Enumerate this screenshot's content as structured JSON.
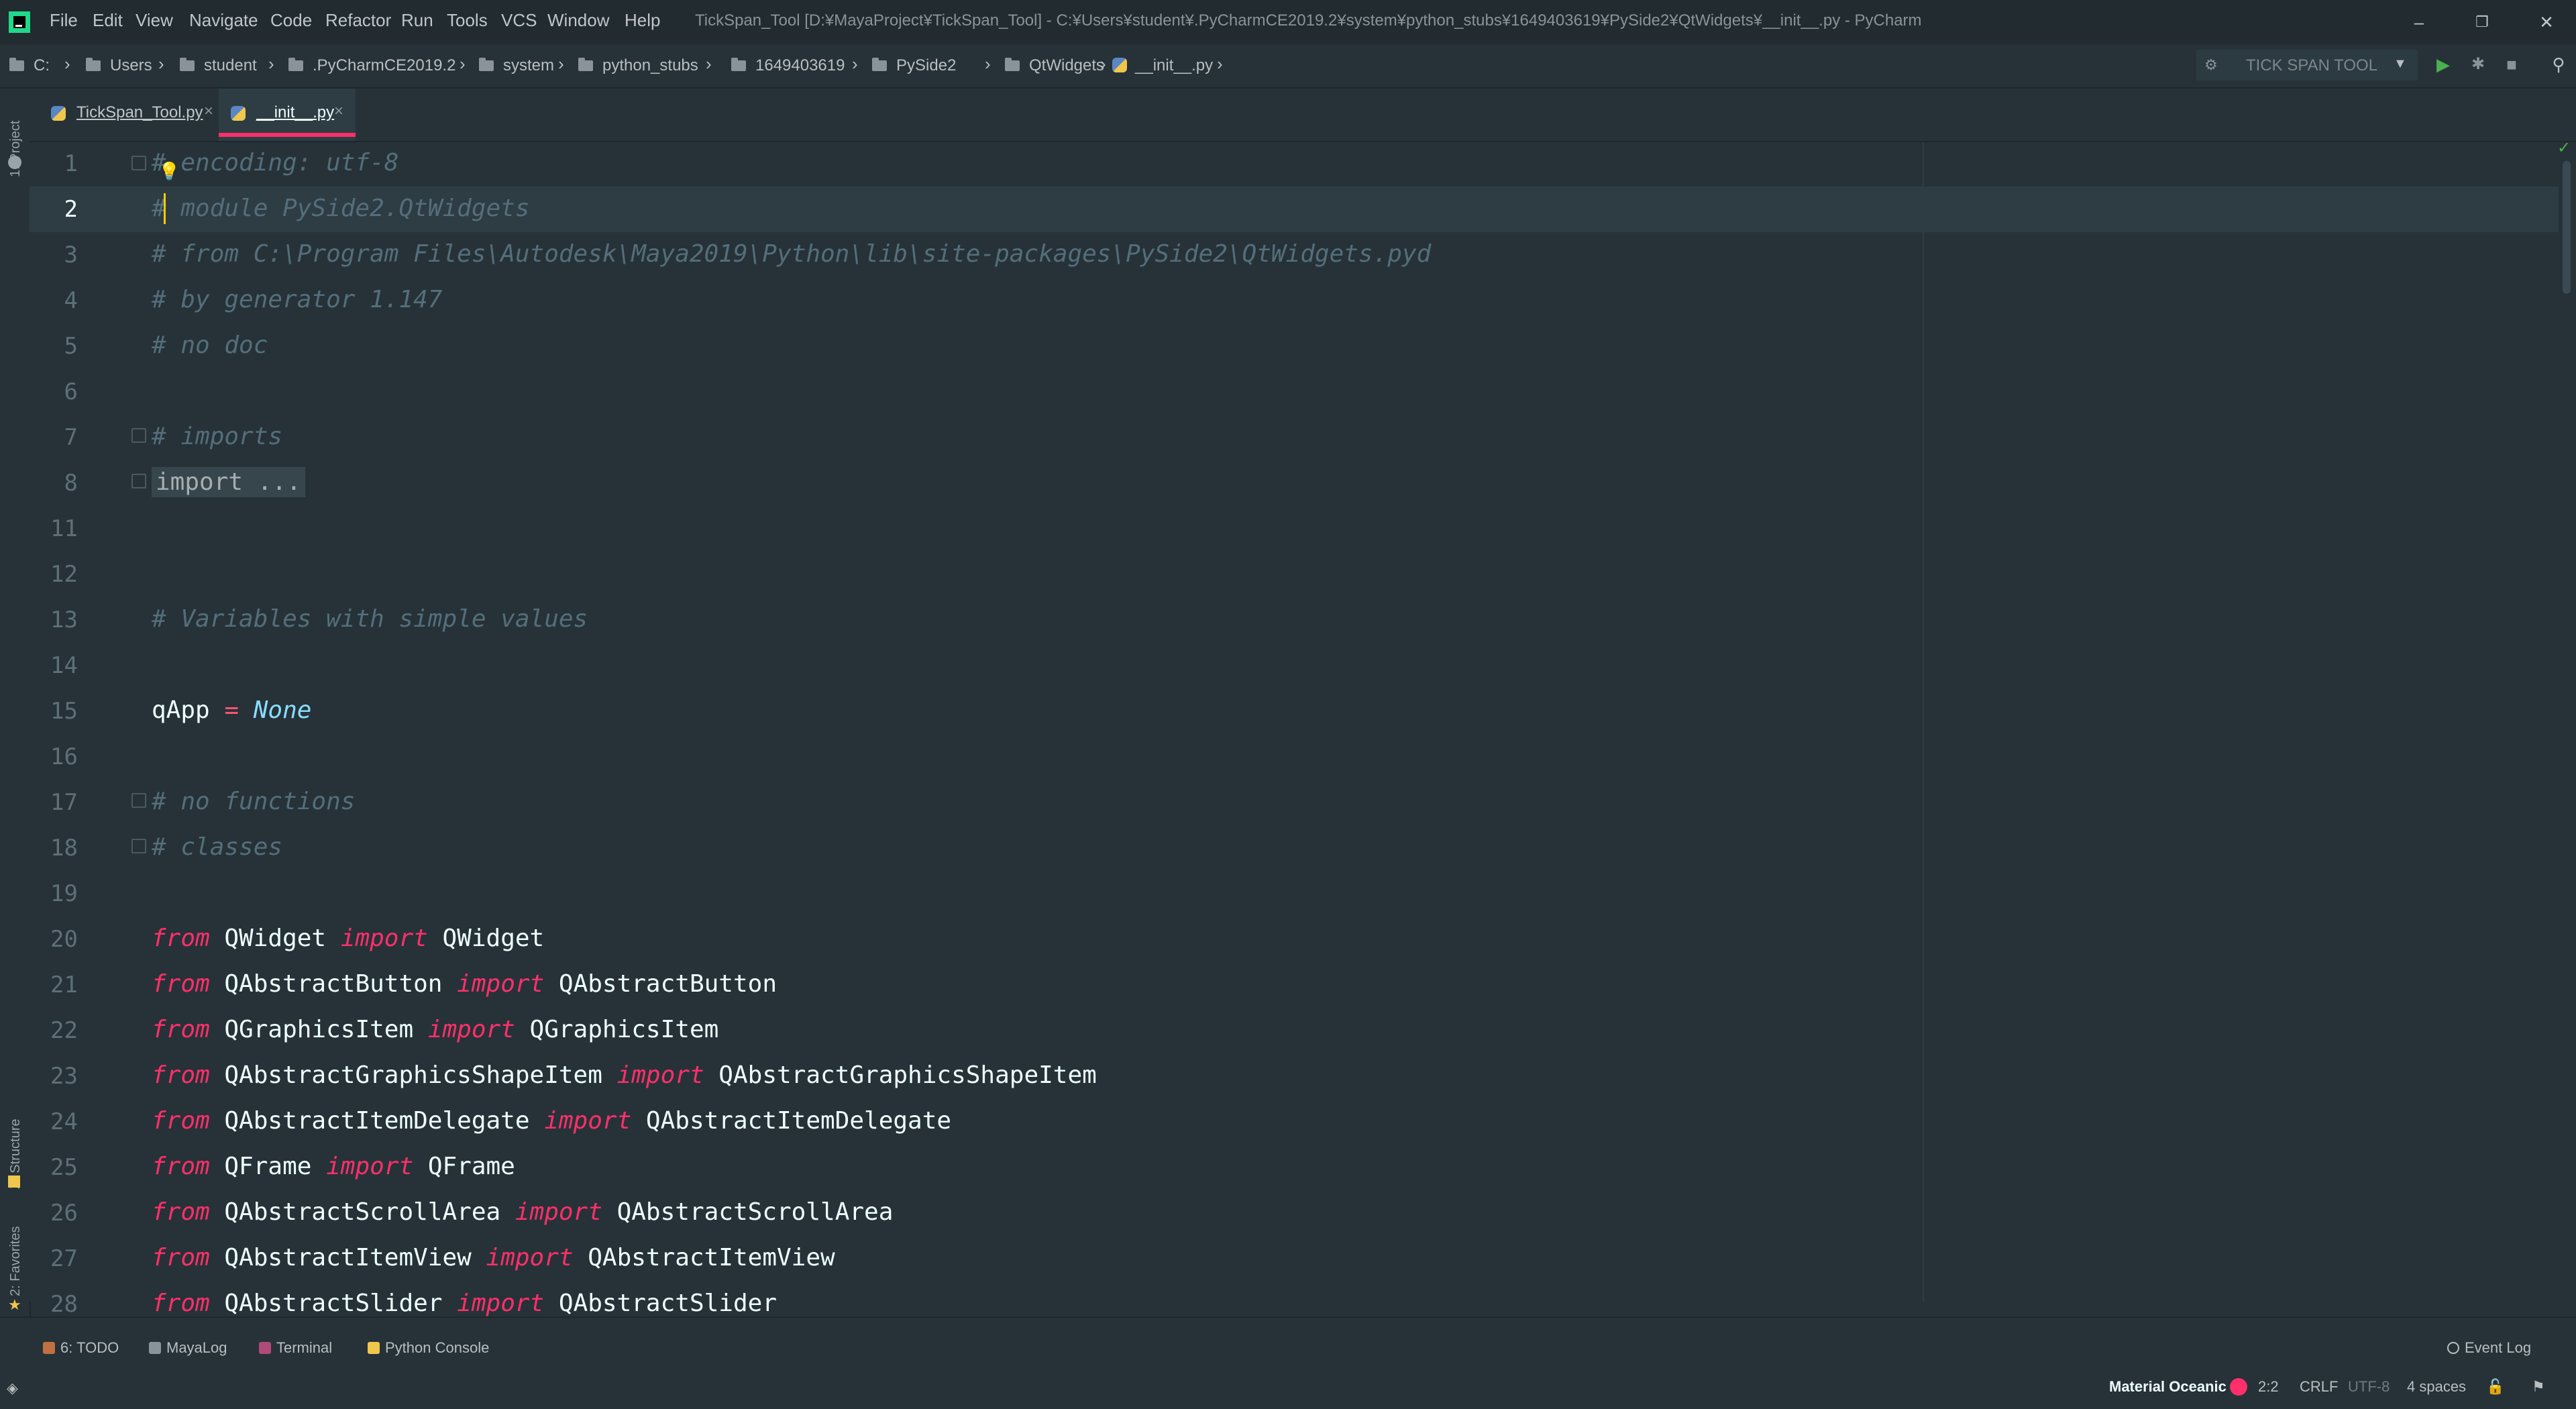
{
  "titlebar": {
    "menu": [
      "File",
      "Edit",
      "View",
      "Navigate",
      "Code",
      "Refactor",
      "Run",
      "Tools",
      "VCS",
      "Window",
      "Help"
    ],
    "window_title": "TickSpan_Tool [D:¥MayaProject¥TickSpan_Tool] - C:¥Users¥student¥.PyCharmCE2019.2¥system¥python_stubs¥1649403619¥PySide2¥QtWidgets¥__init__.py - PyCharm",
    "controls": {
      "minimize": "–",
      "restore": "❐",
      "close": "✕"
    }
  },
  "breadcrumb": [
    "C:",
    "Users",
    "student",
    ".PyCharmCE2019.2",
    "system",
    "python_stubs",
    "1649403619",
    "PySide2",
    "QtWidgets",
    "__init__.py"
  ],
  "run_config": {
    "label": "TICK SPAN TOOL"
  },
  "left_strip": {
    "project": "1: Project",
    "structure": "Z: Structure",
    "favorites": "2: Favorites"
  },
  "tabs": [
    {
      "label": "TickSpan_Tool.py",
      "active": false
    },
    {
      "label": "__init__.py",
      "active": true
    }
  ],
  "editor": {
    "lines": [
      {
        "n": "1",
        "text": "# encoding: utf-8"
      },
      {
        "n": "2",
        "text": "# module PySide2.QtWidgets"
      },
      {
        "n": "3",
        "text": "# from C:\\Program Files\\Autodesk\\Maya2019\\Python\\lib\\site-packages\\PySide2\\QtWidgets.pyd"
      },
      {
        "n": "4",
        "text": "# by generator 1.147"
      },
      {
        "n": "5",
        "text": "# no doc"
      },
      {
        "n": "6",
        "text": ""
      },
      {
        "n": "7",
        "text": "# imports"
      },
      {
        "n": "8",
        "text": "import ..."
      },
      {
        "n": "11",
        "text": ""
      },
      {
        "n": "12",
        "text": ""
      },
      {
        "n": "13",
        "text": "# Variables with simple values"
      },
      {
        "n": "14",
        "text": ""
      },
      {
        "n": "15",
        "var": "qApp",
        "op": "=",
        "val": "None"
      },
      {
        "n": "16",
        "text": ""
      },
      {
        "n": "17",
        "text": "# no functions"
      },
      {
        "n": "18",
        "text": "# classes"
      },
      {
        "n": "19",
        "text": ""
      },
      {
        "n": "20",
        "mod": "QWidget",
        "name": "QWidget"
      },
      {
        "n": "21",
        "mod": "QAbstractButton",
        "name": "QAbstractButton"
      },
      {
        "n": "22",
        "mod": "QGraphicsItem",
        "name": "QGraphicsItem"
      },
      {
        "n": "23",
        "mod": "QAbstractGraphicsShapeItem",
        "name": "QAbstractGraphicsShapeItem"
      },
      {
        "n": "24",
        "mod": "QAbstractItemDelegate",
        "name": "QAbstractItemDelegate"
      },
      {
        "n": "25",
        "mod": "QFrame",
        "name": "QFrame"
      },
      {
        "n": "26",
        "mod": "QAbstractScrollArea",
        "name": "QAbstractScrollArea"
      },
      {
        "n": "27",
        "mod": "QAbstractItemView",
        "name": "QAbstractItemView"
      },
      {
        "n": "28",
        "mod": "QAbstractSlider",
        "name": "QAbstractSlider"
      }
    ],
    "kw_from": "from",
    "kw_import": "import"
  },
  "toolwindows": {
    "todo": "6: TODO",
    "mayalog": "MayaLog",
    "terminal": "Terminal",
    "python_console": "Python Console",
    "event_log": "Event Log"
  },
  "statusbar": {
    "theme": "Material Oceanic",
    "position": "2:2",
    "line_sep": "CRLF",
    "encoding": "UTF-8",
    "indent": "4 spaces"
  },
  "colors": {
    "accent": "#ff2f6a",
    "bg": "#263238",
    "comment": "#546e7a",
    "constant": "#89ddff"
  }
}
